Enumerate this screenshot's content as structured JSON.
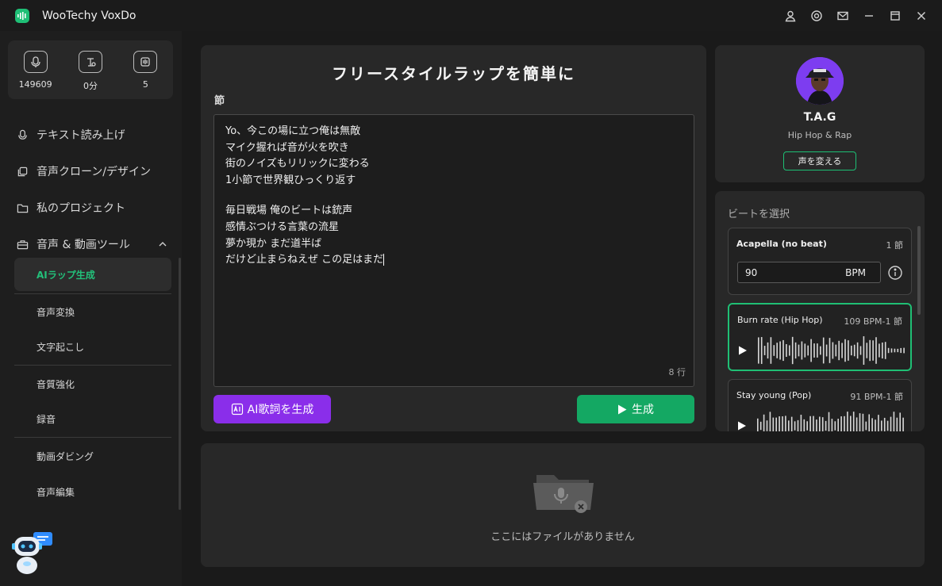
{
  "app": {
    "title": "WooTechy VoxDo"
  },
  "stats": [
    {
      "value": "149609",
      "icon": "character-icon"
    },
    {
      "value": "0分",
      "icon": "time-icon"
    },
    {
      "value": "5",
      "icon": "clone-icon"
    }
  ],
  "nav": {
    "tts": "テキスト読み上げ",
    "clone": "音声クローン/デザイン",
    "projects": "私のプロジェクト",
    "tools": "音声 & 動画ツール",
    "sub": {
      "rap": "AIラップ生成",
      "voice_change": "音声変換",
      "transcribe": "文字起こし",
      "enhance": "音質強化",
      "record": "録音",
      "dubbing": "動画ダビング",
      "edit": "音声編集"
    }
  },
  "main": {
    "title": "フリースタイルラップを簡単に",
    "verse_label": "節",
    "lyrics": [
      "Yo、今この場に立つ俺は無敵",
      "マイク握れば音が火を吹き",
      "街のノイズもリリックに変わる",
      "1小節で世界観ひっくり返す",
      "毎日戦場 俺のビートは銃声",
      "感情ぶつける言葉の流星",
      "夢か現か まだ道半ば",
      "だけど止まらねえぜ この足はまだ"
    ],
    "line_count": "8 行",
    "ai_button": "AI歌詞を生成",
    "generate_button": "生成"
  },
  "artist": {
    "name": "T.A.G",
    "genre": "Hip Hop & Rap",
    "change_voice": "声を変える"
  },
  "beats": {
    "title": "ビートを選択",
    "items": [
      {
        "name": "Acapella (no beat)",
        "info": "1 節",
        "bpm_value": "90",
        "bpm_unit": "BPM"
      },
      {
        "name": "Burn rate (Hip Hop)",
        "info": "109 BPM-1 節"
      },
      {
        "name": "Stay young (Pop)",
        "info": "91 BPM-1 節"
      }
    ]
  },
  "files": {
    "empty_text": "ここにはファイルがありません"
  },
  "colors": {
    "accent": "#1fbf74",
    "purple": "#8a2eea",
    "generate": "#14a863"
  }
}
